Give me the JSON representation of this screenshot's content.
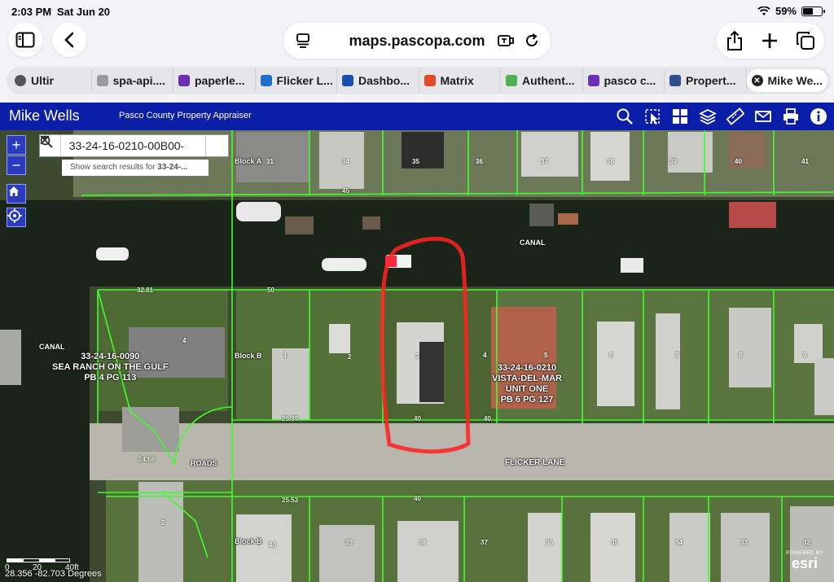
{
  "status_bar": {
    "time": "2:03 PM",
    "date": "Sat Jun 20",
    "battery": "59%",
    "battery_level": 0.59
  },
  "browser": {
    "url": "maps.pascopa.com",
    "tabs": [
      {
        "label": "Ultir",
        "icon": "globe-icon",
        "color": "#555555"
      },
      {
        "label": "spa-api....",
        "icon": "letter-a-icon",
        "color": "#9a9aa5"
      },
      {
        "label": "paperle...",
        "icon": "yahoo-icon",
        "color": "#6b2fb5"
      },
      {
        "label": "Flicker L...",
        "icon": "flicker-icon",
        "color": "#1f6fd1"
      },
      {
        "label": "Dashbo...",
        "icon": "gear-icon",
        "color": "#1a4fb0"
      },
      {
        "label": "Matrix",
        "icon": "matrix-icon",
        "color": "#e24a2b"
      },
      {
        "label": "Authent...",
        "icon": "leaf-icon",
        "color": "#4caf50"
      },
      {
        "label": "pasco c...",
        "icon": "yahoo-icon",
        "color": "#6b2fb5"
      },
      {
        "label": "Propert...",
        "icon": "seal-icon",
        "color": "#2f4f8f"
      },
      {
        "label": "Mike We...",
        "icon": "close-icon",
        "color": "#222222"
      }
    ]
  },
  "app": {
    "title": "Mike Wells",
    "subtitle": "Pasco County Property Appraiser",
    "tools": [
      "search-icon",
      "identify-icon",
      "grid-icon",
      "layers-icon",
      "measure-icon",
      "mail-icon",
      "print-icon",
      "info-icon"
    ],
    "header_color": "#0a1ea8"
  },
  "search": {
    "value": "33-24-16-0210-00B00-0",
    "hint_prefix": "Show search results for",
    "hint_query": "33-24-..."
  },
  "map_labels": {
    "block_a": "Block A",
    "block_b_top": "Block B",
    "block_b_bottom": "Block B",
    "canal_top": "CANAL",
    "canal_left": "CANAL",
    "roads": "ROADS",
    "street": "FLICKER LANE",
    "parcel_left": [
      "33-24-16-0090",
      "SEA RANCH ON THE GULF",
      "PB 4 PG 113"
    ],
    "parcel_right": [
      "33-24-16-0210",
      "VISTA-DEL-MAR",
      "UNIT ONE",
      "PB 6 PG 127"
    ],
    "lots_top": [
      "31",
      "34",
      "35",
      "36",
      "37",
      "38",
      "39",
      "40",
      "41"
    ],
    "lots_mid": [
      "4",
      "1",
      "2",
      "3",
      "4",
      "5",
      "6",
      "7",
      "8",
      "9"
    ],
    "lots_bottom": [
      "2",
      "40",
      "39",
      "38",
      "37",
      "36",
      "35",
      "34",
      "33",
      "32"
    ],
    "dims": [
      "50",
      "45",
      "32.81",
      "50",
      "40",
      "40",
      "26.39",
      "24.68",
      "25.53",
      "40",
      "10",
      "20"
    ]
  },
  "scale_bar": {
    "labels": [
      "0",
      "20",
      "40ft"
    ]
  },
  "coordinates": "28.356 -82.703 Degrees",
  "esri": {
    "powered": "POWERED BY",
    "brand": "esri"
  }
}
